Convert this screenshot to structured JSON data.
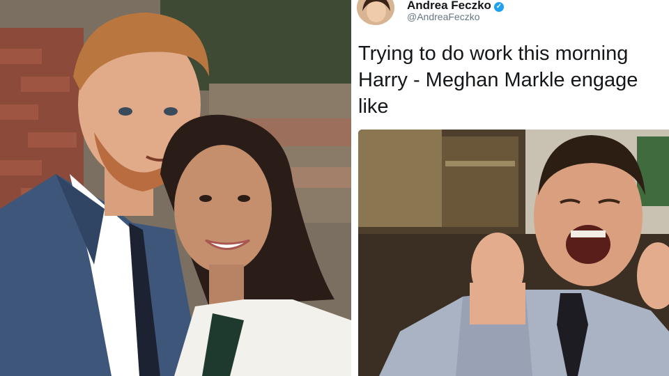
{
  "tweet": {
    "author_name": "Andrea Feczko",
    "author_handle": "@AndreaFeczko",
    "text": "Trying to do work this morning\nHarry - Meghan Markle engage\nlike"
  },
  "colors": {
    "verified": "#1da1f2",
    "handle": "#657786",
    "text": "#14171a"
  },
  "icons": {
    "verified": "verified-badge-icon"
  }
}
